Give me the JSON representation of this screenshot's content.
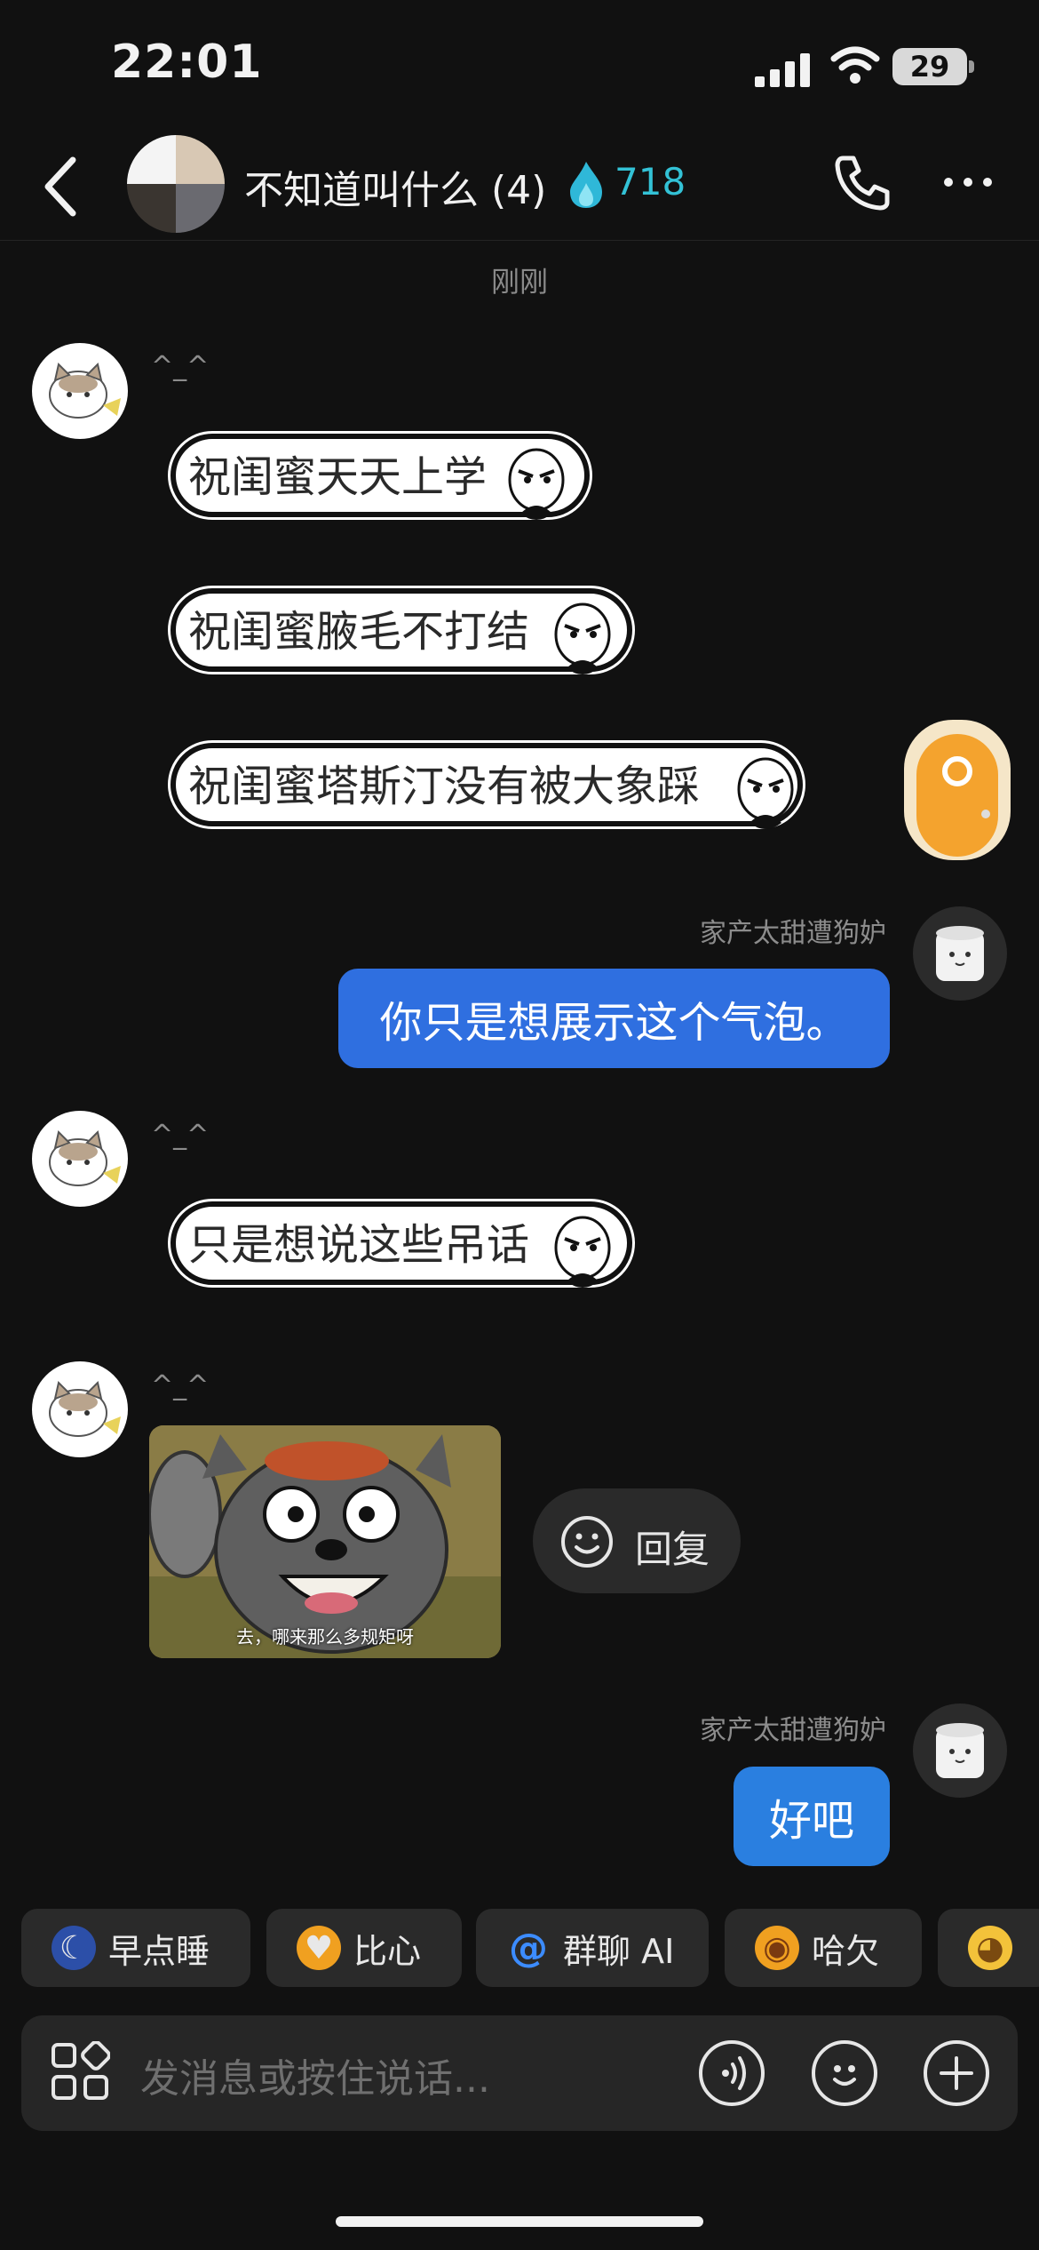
{
  "status_bar": {
    "time": "22:01",
    "battery": "29"
  },
  "header": {
    "title": "不知道叫什么 (4)",
    "streak": "718"
  },
  "timestamp": "刚刚",
  "messages": [
    {
      "nick": "^_^",
      "texts": [
        "祝闺蜜天天上学",
        "祝闺蜜腋毛不打结",
        "祝闺蜜塔斯汀没有被大象踩"
      ]
    },
    {
      "nick": "家产太甜遭狗妒",
      "text": "你只是想展示这个气泡。"
    },
    {
      "nick": "^_^",
      "text": "只是想说这些吊话"
    },
    {
      "nick": "^_^",
      "image_caption": "去，哪来那么多规矩呀"
    },
    {
      "nick": "家产太甜遭狗妒",
      "text": "好吧"
    }
  ],
  "reply_label": "回复",
  "chips": [
    "早点睡",
    "比心",
    "群聊 AI",
    "哈欠"
  ],
  "input": {
    "placeholder": "发消息或按住说话..."
  }
}
